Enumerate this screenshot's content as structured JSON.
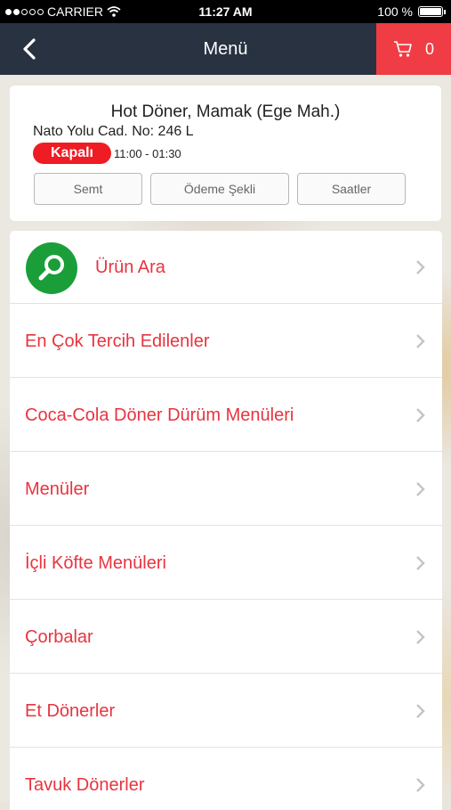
{
  "status_bar": {
    "carrier": "CARRIER",
    "time": "11:27 AM",
    "battery": "100 %"
  },
  "nav": {
    "title": "Menü",
    "cart_count": "0"
  },
  "restaurant": {
    "name": "Hot Döner, Mamak (Ege Mah.)",
    "address": "Nato Yolu Cad. No: 246 L",
    "status": "Kapalı",
    "hours": "11:00 - 01:30",
    "buttons": [
      "Semt",
      "Ödeme Şekli",
      "Saatler"
    ]
  },
  "menu": {
    "search_label": "Ürün Ara",
    "items": [
      "En Çok Tercih Edilenler",
      "Coca-Cola Döner Dürüm Menüleri",
      "Menüler",
      "İçli Köfte Menüleri",
      "Çorbalar",
      "Et Dönerler",
      "Tavuk Dönerler"
    ]
  },
  "colors": {
    "navbar": "#283241",
    "accent": "#f03c44",
    "closed_badge": "#ef1c24",
    "search_icon_bg": "#1a9e3a",
    "menu_text": "#e8343f"
  }
}
